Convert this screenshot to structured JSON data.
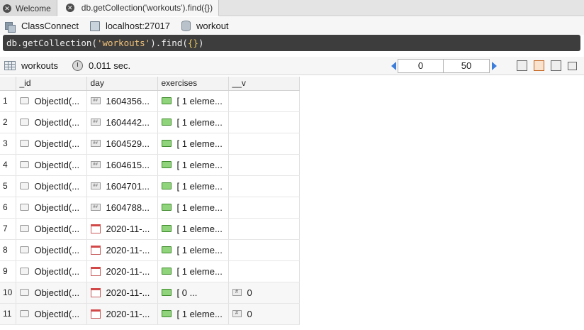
{
  "tabs": [
    {
      "label": "Welcome",
      "active": false
    },
    {
      "label": "db.getCollection('workouts').find({})",
      "active": true
    }
  ],
  "connection": {
    "name": "ClassConnect",
    "host": "localhost:27017",
    "database": "workout"
  },
  "query": {
    "prefix": "db.getCollection(",
    "collection_arg": "'workouts'",
    "middle": ").find(",
    "filter_arg": "{}",
    "suffix": ")"
  },
  "results_toolbar": {
    "collection": "workouts",
    "time": "0.011 sec.",
    "skip": "0",
    "limit": "50"
  },
  "columns": [
    "_id",
    "day",
    "exercises",
    "__v"
  ],
  "rows": [
    {
      "n": "1",
      "id": "ObjectId(...",
      "day": "1604356...",
      "day_type": "number",
      "exercises": "[ 1 eleme...",
      "v": ""
    },
    {
      "n": "2",
      "id": "ObjectId(...",
      "day": "1604442...",
      "day_type": "number",
      "exercises": "[ 1 eleme...",
      "v": ""
    },
    {
      "n": "3",
      "id": "ObjectId(...",
      "day": "1604529...",
      "day_type": "number",
      "exercises": "[ 1 eleme...",
      "v": ""
    },
    {
      "n": "4",
      "id": "ObjectId(...",
      "day": "1604615...",
      "day_type": "number",
      "exercises": "[ 1 eleme...",
      "v": ""
    },
    {
      "n": "5",
      "id": "ObjectId(...",
      "day": "1604701...",
      "day_type": "number",
      "exercises": "[ 1 eleme...",
      "v": ""
    },
    {
      "n": "6",
      "id": "ObjectId(...",
      "day": "1604788...",
      "day_type": "number",
      "exercises": "[ 1 eleme...",
      "v": ""
    },
    {
      "n": "7",
      "id": "ObjectId(...",
      "day": "2020-11-...",
      "day_type": "date",
      "exercises": "[ 1 eleme...",
      "v": ""
    },
    {
      "n": "8",
      "id": "ObjectId(...",
      "day": "2020-11-...",
      "day_type": "date",
      "exercises": "[ 1 eleme...",
      "v": ""
    },
    {
      "n": "9",
      "id": "ObjectId(...",
      "day": "2020-11-...",
      "day_type": "date",
      "exercises": "[ 1 eleme...",
      "v": ""
    },
    {
      "n": "10",
      "id": "ObjectId(...",
      "day": "2020-11-...",
      "day_type": "date",
      "exercises": "[ 0 ...",
      "v": "0"
    },
    {
      "n": "11",
      "id": "ObjectId(...",
      "day": "2020-11-...",
      "day_type": "date",
      "exercises": "[ 1 eleme...",
      "v": "0"
    }
  ],
  "colors": {
    "query_bg": "#3d3d3d",
    "string_literal": "#f2c27a",
    "pager_arrow": "#3d7edb"
  }
}
